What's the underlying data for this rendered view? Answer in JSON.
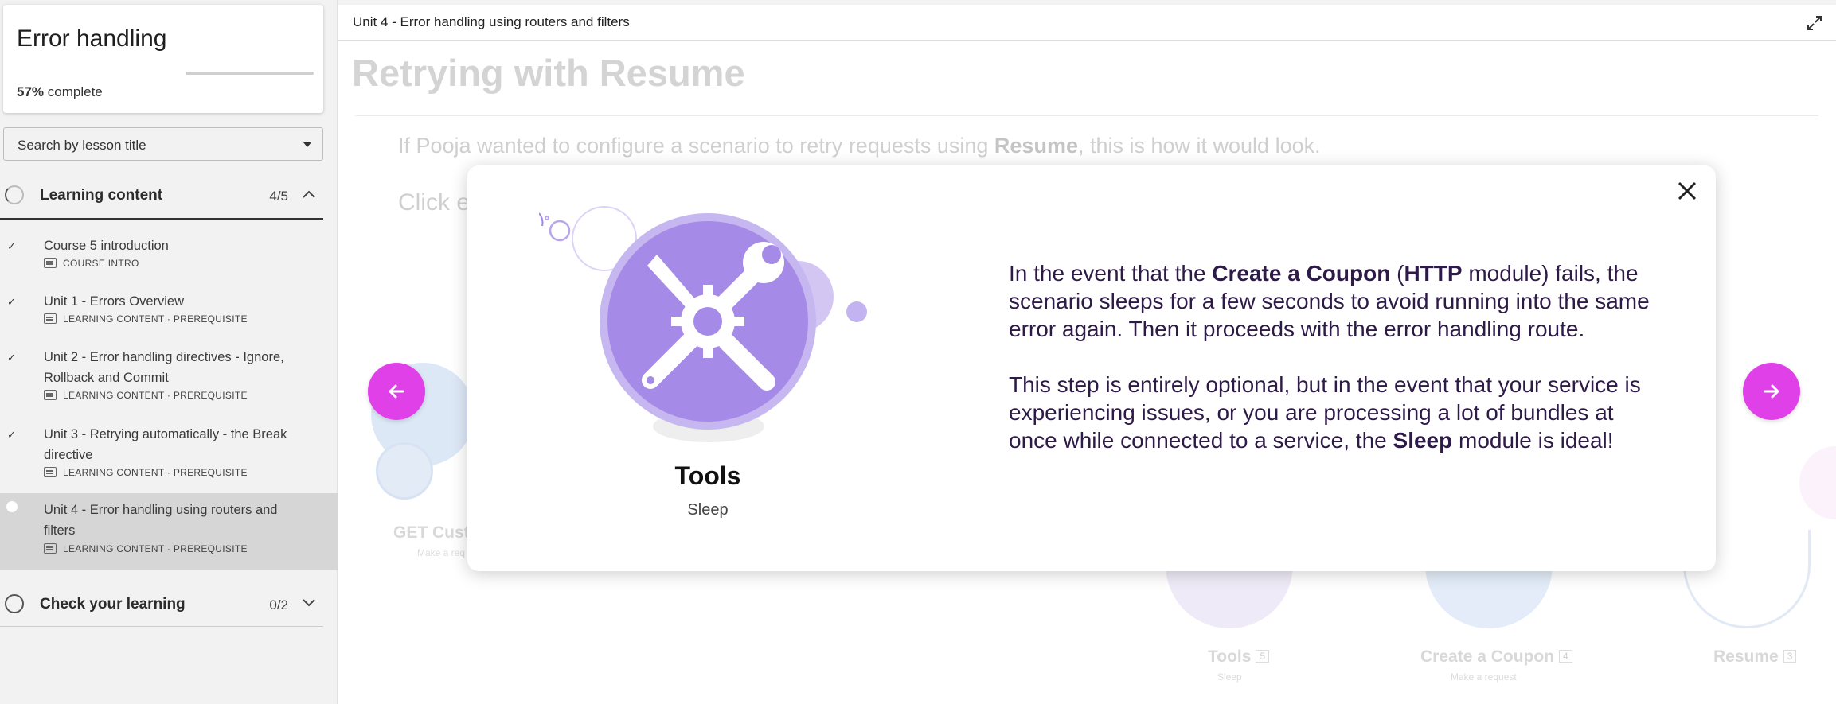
{
  "sidebar": {
    "course_title": "Error handling",
    "progress_percent": 57,
    "progress_value": "57%",
    "progress_suffix": "complete",
    "search_placeholder": "Search by lesson title",
    "sections": [
      {
        "label": "Learning content",
        "count": "4/5",
        "lessons": [
          {
            "title": "Course 5 introduction",
            "meta": "COURSE INTRO",
            "status": "done"
          },
          {
            "title": "Unit 1 - Errors Overview",
            "meta": "LEARNING CONTENT · PREREQUISITE",
            "status": "done"
          },
          {
            "title": "Unit 2 - Error handling directives - Ignore, Rollback and Commit",
            "meta": "LEARNING CONTENT · PREREQUISITE",
            "status": "done"
          },
          {
            "title": "Unit 3 - Retrying automatically - the Break directive",
            "meta": "LEARNING CONTENT · PREREQUISITE",
            "status": "done"
          },
          {
            "title": "Unit 4 - Error handling using routers and filters",
            "meta": "LEARNING CONTENT · PREREQUISITE",
            "status": "current"
          }
        ]
      },
      {
        "label": "Check your learning",
        "count": "0/2"
      }
    ]
  },
  "main": {
    "unit_title": "Unit 4 - Error handling using routers and filters",
    "lesson_title": "Retrying with Resume",
    "intro_before": "If Pooja wanted to configure a scenario to retry requests using ",
    "intro_bold": "Resume",
    "intro_after": ", this is how it would look.",
    "click_text": "Click e",
    "background_nodes": [
      {
        "label": "GET Custo",
        "sub": "Make a req"
      },
      {
        "label": "Tools",
        "badge": "5",
        "sub": "Sleep"
      },
      {
        "label": "Create a Coupon",
        "badge": "4",
        "sub": "Make a request"
      },
      {
        "label": "Resume",
        "badge": "3"
      }
    ]
  },
  "modal": {
    "module_name": "Tools",
    "module_action": "Sleep",
    "p1_a": "In the event that the ",
    "p1_b": "Create a Coupon",
    "p1_c": " (",
    "p1_d": "HTTP",
    "p1_e": " module) fails, the scenario sleeps for a few seconds to avoid running into the same error again. Then it proceeds with the error handling route.",
    "p2_a": "This step is entirely optional, but in the event that your service is experiencing issues, or you are processing a lot of bundles at once while connected to a service, the ",
    "p2_b": "Sleep",
    "p2_c": " module is ideal!"
  },
  "colors": {
    "accent": "#e040e8",
    "tools_purple": "#a68ae8",
    "modal_text": "#2e1a47"
  },
  "icons": {
    "prev": "arrow-left-icon",
    "next": "arrow-right-icon",
    "close": "close-icon",
    "expand": "expand-icon",
    "module": "tools-icon"
  }
}
